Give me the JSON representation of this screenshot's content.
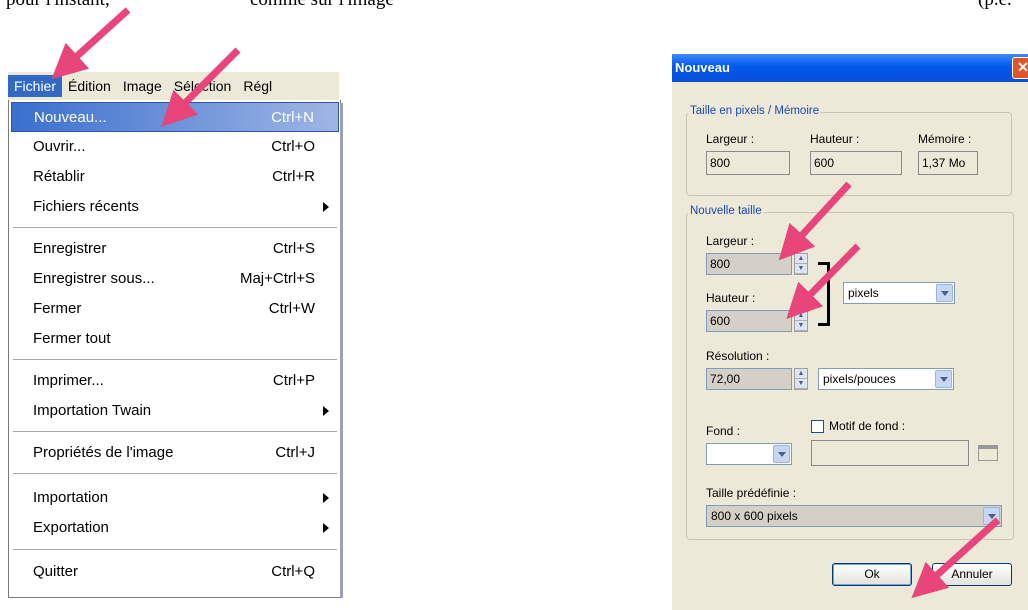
{
  "top_text": [
    "pour l'instant,",
    "comme sur l'image",
    "",
    "(p.e."
  ],
  "menubar": [
    "Fichier",
    "Édition",
    "Image",
    "Sélection",
    "Régl"
  ],
  "menu": [
    {
      "label": "Nouveau...",
      "shortcut": "Ctrl+N"
    },
    {
      "label": "Ouvrir...",
      "shortcut": "Ctrl+O"
    },
    {
      "label": "Rétablir",
      "shortcut": "Ctrl+R"
    },
    {
      "label": "Fichiers récents",
      "shortcut": ""
    },
    {
      "label": "Enregistrer",
      "shortcut": "Ctrl+S"
    },
    {
      "label": "Enregistrer sous...",
      "shortcut": "Maj+Ctrl+S"
    },
    {
      "label": "Fermer",
      "shortcut": "Ctrl+W"
    },
    {
      "label": "Fermer tout",
      "shortcut": ""
    },
    {
      "label": "Imprimer...",
      "shortcut": "Ctrl+P"
    },
    {
      "label": "Importation Twain",
      "shortcut": ""
    },
    {
      "label": "Propriétés de l'image",
      "shortcut": "Ctrl+J"
    },
    {
      "label": "Importation",
      "shortcut": ""
    },
    {
      "label": "Exportation",
      "shortcut": ""
    },
    {
      "label": "Quitter",
      "shortcut": "Ctrl+Q"
    }
  ],
  "dialog": {
    "title": "Nouveau",
    "close": "✕",
    "group1": {
      "title": "Taille en pixels / Mémoire",
      "width_label": "Largeur :",
      "width_value": "800",
      "height_label": "Hauteur :",
      "height_value": "600",
      "memory_label": "Mémoire :",
      "memory_value": "1,37 Mo"
    },
    "group2": {
      "title": "Nouvelle taille",
      "width_label": "Largeur :",
      "width_value": "800",
      "height_label": "Hauteur :",
      "height_value": "600",
      "unit_value": "pixels",
      "resolution_label": "Résolution :",
      "resolution_value": "72,00",
      "resolution_unit": "pixels/pouces",
      "background_label": "Fond :",
      "pattern_label": "Motif de fond :",
      "preset_label": "Taille prédéfinie :",
      "preset_value": "800 x 600 pixels"
    },
    "ok_label": "Ok",
    "cancel_label": "Annuler"
  },
  "colors": {
    "highlight": "#316ac5",
    "arrow": "#e8457a",
    "titlebar": "#0058ee"
  }
}
